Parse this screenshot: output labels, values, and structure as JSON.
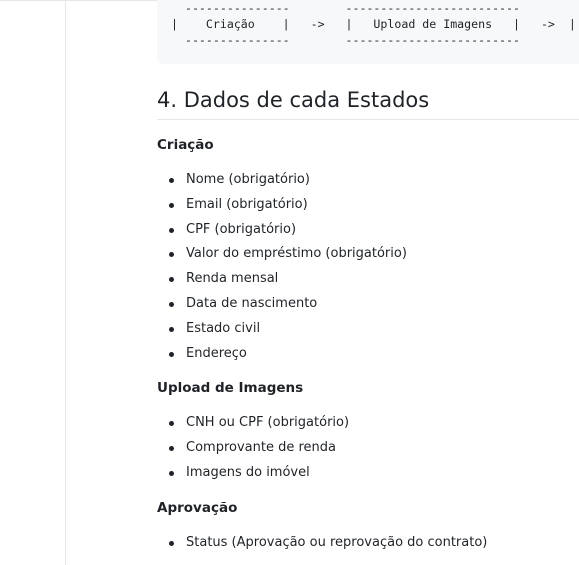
{
  "code_block": {
    "lines": [
      "  ---------------        -------------------------       ",
      "|    Criação    |   ->   |   Upload de Imagens   |   ->  |",
      "  ---------------        -------------------------       "
    ]
  },
  "heading": "4. Dados de cada Estados",
  "sections": [
    {
      "title": "Criação",
      "items": [
        "Nome (obrigatório)",
        "Email (obrigatório)",
        "CPF (obrigatório)",
        "Valor do empréstimo (obrigatório)",
        "Renda mensal",
        "Data de nascimento",
        "Estado civil",
        "Endereço"
      ]
    },
    {
      "title": "Upload de Imagens",
      "items": [
        "CNH ou CPF (obrigatório)",
        "Comprovante de renda",
        "Imagens do imóvel"
      ]
    },
    {
      "title": "Aprovação",
      "items": [
        "Status (Aprovação ou reprovação do contrato)"
      ]
    }
  ]
}
